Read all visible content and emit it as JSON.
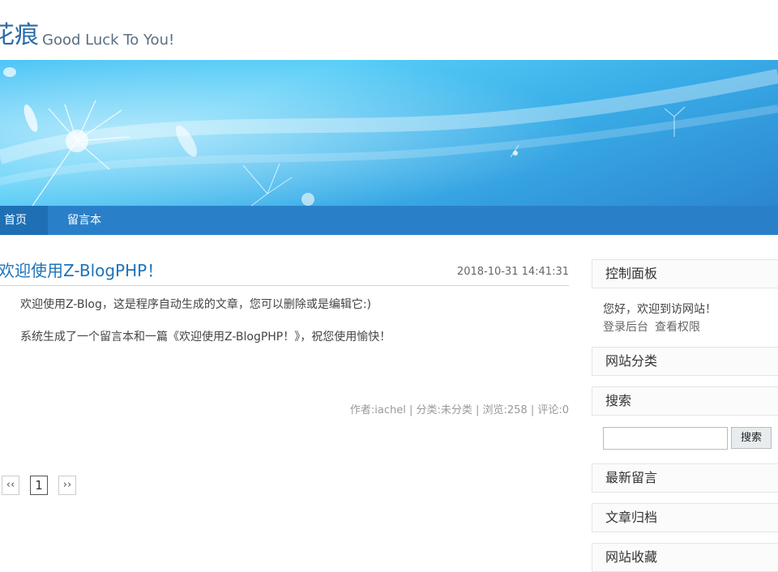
{
  "header": {
    "title": "花痕",
    "subtitle": "Good Luck To You!"
  },
  "nav": {
    "items": [
      {
        "label": "首页",
        "active": true
      },
      {
        "label": "留言本",
        "active": false
      }
    ]
  },
  "article": {
    "title": "欢迎使用Z-BlogPHP！",
    "date": "2018-10-31 14:41:31",
    "paragraphs": [
      "欢迎使用Z-Blog，这是程序自动生成的文章，您可以删除或是编辑它:)",
      "系统生成了一个留言本和一篇《欢迎使用Z-BlogPHP！》，祝您使用愉快！"
    ],
    "meta": "作者:iachel | 分类:未分类 | 浏览:258 | 评论:0"
  },
  "pagination": {
    "prev": "‹‹",
    "current": "1",
    "next": "››"
  },
  "sidebar": {
    "control_panel": {
      "title": "控制面板",
      "welcome": "您好，欢迎到访网站！",
      "links": [
        "登录后台",
        "查看权限"
      ]
    },
    "categories_title": "网站分类",
    "search": {
      "title": "搜索",
      "placeholder": "",
      "button": "搜索"
    },
    "latest_comments_title": "最新留言",
    "archives_title": "文章归档",
    "favorites_title": "网站收藏"
  },
  "colors": {
    "nav_bg": "#2a80c8",
    "link": "#1d73ba"
  }
}
